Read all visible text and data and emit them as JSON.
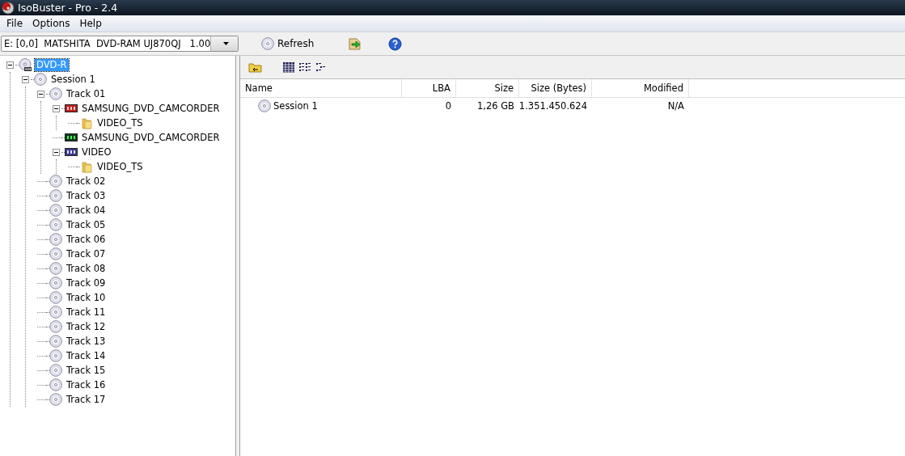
{
  "window": {
    "title": "IsoBuster - Pro - 2.4"
  },
  "menu": [
    "File",
    "Options",
    "Help"
  ],
  "toolbar": {
    "device": "E: [0,0]  MATSHITA  DVD-RAM UJ870QJ   1.00",
    "refresh": "Refresh"
  },
  "tree": [
    {
      "label": "DVD-R",
      "kind": "drive",
      "selected": true,
      "expanded": true,
      "children": [
        {
          "label": "Session 1",
          "kind": "disc",
          "selected": false,
          "expanded": true,
          "children": [
            {
              "label": "Track 01",
              "kind": "disc",
              "selected": false,
              "expanded": true,
              "children": [
                {
                  "label": "SAMSUNG_DVD_CAMCORDER",
                  "kind": "iso",
                  "selected": false,
                  "expanded": true,
                  "children": [
                    {
                      "label": "VIDEO_TS",
                      "kind": "folder",
                      "selected": false
                    }
                  ]
                },
                {
                  "label": "SAMSUNG_DVD_CAMCORDER",
                  "kind": "udf",
                  "selected": false
                },
                {
                  "label": "VIDEO",
                  "kind": "ifo",
                  "selected": false,
                  "expanded": true,
                  "children": [
                    {
                      "label": "VIDEO_TS",
                      "kind": "folder",
                      "selected": false
                    }
                  ]
                }
              ]
            },
            {
              "label": "Track 02",
              "kind": "disc",
              "selected": false
            },
            {
              "label": "Track 03",
              "kind": "disc",
              "selected": false
            },
            {
              "label": "Track 04",
              "kind": "disc",
              "selected": false
            },
            {
              "label": "Track 05",
              "kind": "disc",
              "selected": false
            },
            {
              "label": "Track 06",
              "kind": "disc",
              "selected": false
            },
            {
              "label": "Track 07",
              "kind": "disc",
              "selected": false
            },
            {
              "label": "Track 08",
              "kind": "disc",
              "selected": false
            },
            {
              "label": "Track 09",
              "kind": "disc",
              "selected": false
            },
            {
              "label": "Track 10",
              "kind": "disc",
              "selected": false
            },
            {
              "label": "Track 11",
              "kind": "disc",
              "selected": false
            },
            {
              "label": "Track 12",
              "kind": "disc",
              "selected": false
            },
            {
              "label": "Track 13",
              "kind": "disc",
              "selected": false
            },
            {
              "label": "Track 14",
              "kind": "disc",
              "selected": false
            },
            {
              "label": "Track 15",
              "kind": "disc",
              "selected": false
            },
            {
              "label": "Track 16",
              "kind": "disc",
              "selected": false
            },
            {
              "label": "Track 17",
              "kind": "disc",
              "selected": false
            }
          ]
        }
      ]
    }
  ],
  "table": {
    "columns": [
      "Name",
      "LBA",
      "Size",
      "Size (Bytes)",
      "Modified"
    ],
    "rows": [
      [
        "Session 1",
        "0",
        "1,26 GB",
        "1.351.450.624",
        "N/A"
      ]
    ]
  }
}
